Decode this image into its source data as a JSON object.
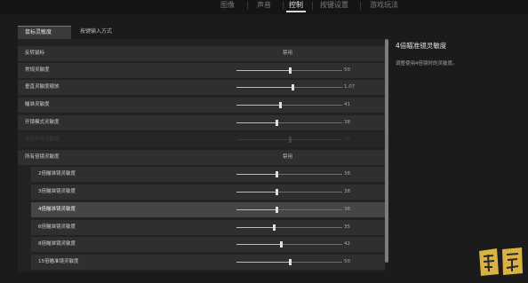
{
  "topnav": {
    "tabs": [
      {
        "label": "图像",
        "active": false
      },
      {
        "label": "声音",
        "active": false
      },
      {
        "label": "控制",
        "active": true
      },
      {
        "label": "按键设置",
        "active": false
      },
      {
        "label": "游戏玩法",
        "active": false
      }
    ]
  },
  "subtabs": [
    {
      "label": "鼠标灵敏度",
      "active": true
    },
    {
      "label": "按键输入方式",
      "active": false
    }
  ],
  "settings": {
    "rows": [
      {
        "label": "反转鼠标",
        "type": "option",
        "value": "禁用"
      },
      {
        "label": "常规灵敏度",
        "type": "slider",
        "value": "50",
        "level": 0.5
      },
      {
        "label": "垂直灵敏度缩放",
        "type": "slider",
        "value": "1.07",
        "level": 0.53
      },
      {
        "label": "瞄准灵敏度",
        "type": "slider",
        "value": "41",
        "level": 0.41
      },
      {
        "label": "开镜模式灵敏度",
        "type": "slider",
        "value": "38",
        "level": 0.38
      },
      {
        "label": "低倍开镜灵敏度",
        "type": "slider",
        "value": "50",
        "level": 0.5,
        "disabled": true
      },
      {
        "label": "所有倍镜灵敏度",
        "type": "option",
        "value": "禁用"
      },
      {
        "label": "2倍瞄准镜灵敏度",
        "type": "slider",
        "value": "38",
        "level": 0.38,
        "indent": true
      },
      {
        "label": "3倍瞄准镜灵敏度",
        "type": "slider",
        "value": "38",
        "level": 0.38,
        "indent": true
      },
      {
        "label": "4倍瞄准镜灵敏度",
        "type": "slider",
        "value": "38",
        "level": 0.38,
        "indent": true,
        "highlight": true
      },
      {
        "label": "6倍瞄准镜灵敏度",
        "type": "slider",
        "value": "35",
        "level": 0.35,
        "indent": true
      },
      {
        "label": "8倍瞄准镜灵敏度",
        "type": "slider",
        "value": "42",
        "level": 0.42,
        "indent": true
      },
      {
        "label": "15倍瞄准镜灵敏度",
        "type": "slider",
        "value": "50",
        "level": 0.5,
        "indent": true
      }
    ]
  },
  "info": {
    "title": "4倍瞄准镜灵敏度",
    "description": "调整使用4倍镜时的灵敏度。"
  },
  "watermark": {
    "text": "蜗玩"
  },
  "colors": {
    "background": "#1b1b1b",
    "row": "#2f2f2f",
    "row_highlight": "#454545",
    "slider_thumb": "#e0e0e0",
    "watermark": "#f0c24a"
  }
}
